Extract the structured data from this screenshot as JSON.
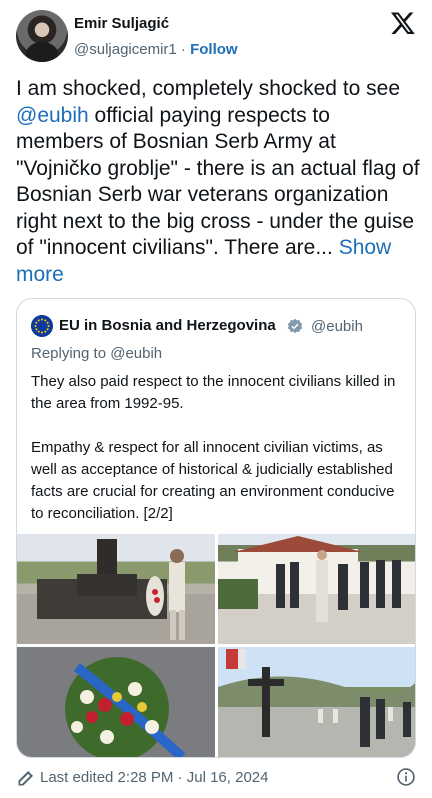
{
  "author": {
    "name": "Emir Suljagić",
    "handle": "@suljagicemir1",
    "separator": " · ",
    "follow_label": "Follow"
  },
  "tweet": {
    "before_mention": "I am shocked, completely shocked to see ",
    "mention": "@eubih",
    "after_mention": " official paying respects to members of Bosnian Serb Army at \"Vojničko groblje\" - there is an actual flag of Bosnian Serb war veterans organization right next to the big cross - under the guise of \"innocent civilians\". There are... ",
    "show_more_label": "Show more"
  },
  "quote": {
    "name": "EU in Bosnia and Herzegovina",
    "handle": "@eubih",
    "replying_to": "Replying to @eubih",
    "paragraph1": "They also paid respect to the innocent civilians killed in the area from 1992-95.",
    "paragraph2": "Empathy & respect for all innocent civilian victims, as well as acceptance of historical & judicially established facts are crucial for creating an environment conducive to reconciliation. [2/2]",
    "photos": [
      "wreath-laying-photo",
      "officials-standing-photo",
      "flower-wreath-photo",
      "cemetery-cross-photo"
    ]
  },
  "footer": {
    "edited": "Last edited 2:28 PM · Jul 16, 2024"
  },
  "colors": {
    "link": "#1d6fb8",
    "muted": "#536471",
    "eu_blue": "#0d3a9c",
    "eu_star": "#ffcc00"
  }
}
